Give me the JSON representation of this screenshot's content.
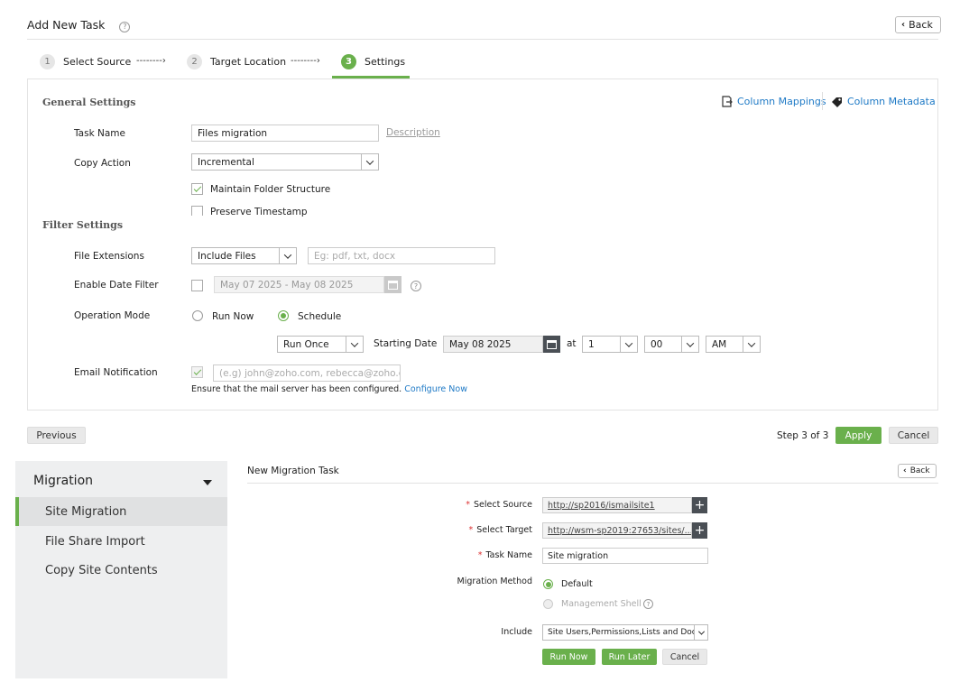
{
  "header": {
    "title": "Add New Task",
    "help": "?",
    "back_label": "Back"
  },
  "steps": [
    {
      "num": "1",
      "label": "Select Source"
    },
    {
      "num": "2",
      "label": "Target Location"
    },
    {
      "num": "3",
      "label": "Settings",
      "active": true
    }
  ],
  "step_arrow": "--------›",
  "general": {
    "title": "General Settings",
    "column_mappings": "Column Mappings",
    "column_metadata": "Column Metadata",
    "task_name_label": "Task Name",
    "task_name_value": "Files migration",
    "description_link": "Description",
    "copy_action_label": "Copy Action",
    "copy_action_value": "Incremental",
    "maintain_folder": "Maintain Folder Structure",
    "maintain_folder_checked": true,
    "preserve_timestamp": "Preserve Timestamp",
    "preserve_timestamp_checked": false
  },
  "filter": {
    "title": "Filter Settings",
    "file_ext_label": "File Extensions",
    "file_ext_select": "Include Files",
    "file_ext_placeholder": "Eg: pdf, txt, docx",
    "date_filter_label": "Enable Date Filter",
    "date_range_placeholder": "May 07 2025 - May 08 2025",
    "operation_label": "Operation Mode",
    "run_now": "Run Now",
    "schedule": "Schedule",
    "selected_mode": "Schedule",
    "run_once": "Run Once",
    "starting_date_label": "Starting Date",
    "starting_date": "May 08 2025",
    "at_label": "at",
    "hour": "1",
    "minute": "00",
    "ampm": "AM",
    "email_label": "Email Notification",
    "email_placeholder": "(e.g) john@zoho.com, rebecca@zoho.co",
    "email_note": "Ensure that the mail server has been configured.",
    "configure_now": "Configure Now"
  },
  "footer": {
    "previous": "Previous",
    "step_text": "Step 3 of 3",
    "apply": "Apply",
    "cancel": "Cancel"
  },
  "sidebar": {
    "heading": "Migration",
    "items": [
      {
        "label": "Site Migration",
        "active": true
      },
      {
        "label": "File Share Import"
      },
      {
        "label": "Copy Site Contents"
      }
    ]
  },
  "migration_task": {
    "title": "New Migration Task",
    "back_label": "Back",
    "select_source_label": "Select Source",
    "select_source_value": "http://sp2016/ismailsite1",
    "select_target_label": "Select Target",
    "select_target_value": "http://wsm-sp2019:27653/sites/...",
    "task_name_label": "Task Name",
    "task_name_value": "Site migration",
    "method_label": "Migration Method",
    "method_default": "Default",
    "method_shell": "Management Shell",
    "include_label": "Include",
    "include_value": "Site Users,Permissions,Lists and Docu",
    "run_now": "Run Now",
    "run_later": "Run Later",
    "cancel": "Cancel",
    "required_mark": "*"
  },
  "colors": {
    "accent": "#6ab04c",
    "link": "#1f7ac6",
    "dark_button": "#4a4f55"
  }
}
